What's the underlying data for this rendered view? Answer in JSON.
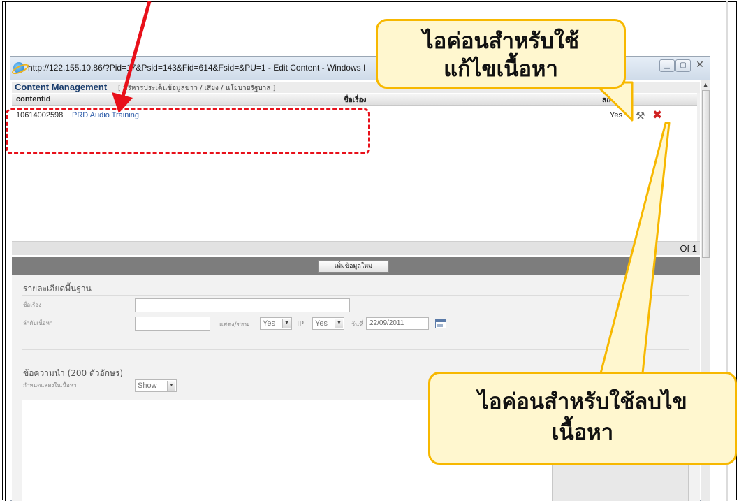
{
  "window": {
    "title": "http://122.155.10.86/?Pid=17&Psid=143&Fid=614&Fsid=&PU=1 - Edit Content - Windows I",
    "min_icon": "minimize-icon",
    "max_icon": "maximize-icon",
    "close_label": "✕"
  },
  "content_management": {
    "title": "Content Management",
    "breadcrumb": "[ บริหารประเด็นข้อมูลข่าว / เสียง / นโยบายรัฐบาล ]"
  },
  "grid": {
    "columns": {
      "id": "contentid",
      "name": "ชื่อเรื่อง",
      "status": "สถานะ"
    },
    "rows": [
      {
        "contentid": "10614002598",
        "name": "PRD Audio Training",
        "status": "Yes",
        "edit_icon": "wrench-hammer-icon",
        "delete_icon": "red-x-icon"
      }
    ]
  },
  "pager": {
    "text": "Of 1"
  },
  "toolbar": {
    "add_label": "เพิ่มข้อมูลใหม่"
  },
  "form": {
    "basic_section": "รายละเอียดพื้นฐาน",
    "subject_label": "ชื่อเรื่อง",
    "order_label": "ลำดับเนื้อหา",
    "show_hide_label": "แสดง/ซ่อน",
    "show_hide_value": "Yes",
    "ip_label": "IP",
    "ip_value": "Yes",
    "date_label": "วันที่",
    "date_value": "22/09/2011",
    "lead_section": "ข้อความนำ (200 ตัวอักษร)",
    "display_label": "กำหนดแสดงในเนื้อหา",
    "display_value": "Show"
  },
  "annotations": {
    "callout_edit_line1": "ไอค่อนสำหรับใช้",
    "callout_edit_line2": "แก้ไขเนื้อหา",
    "callout_delete_line1": "ไอค่อนสำหรับใช้ลบไข",
    "callout_delete_line2": "เนื้อหา",
    "highlight_color": "#e8101a",
    "callout_border_color": "#f7b800",
    "callout_fill_color": "#fff7cf"
  }
}
